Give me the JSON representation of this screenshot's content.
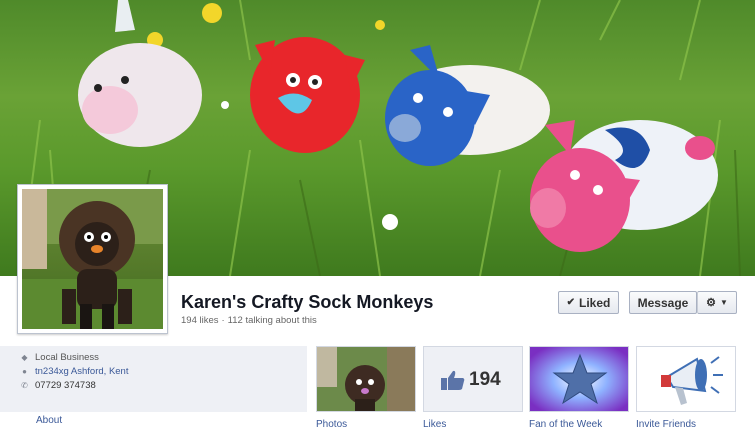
{
  "page": {
    "name": "Karen's Crafty Sock Monkeys",
    "likes_text": "194 likes",
    "talking_text": "112 talking about this",
    "separator": "·"
  },
  "actions": {
    "liked_label": "Liked",
    "message_label": "Message",
    "gear_icon": "gear-icon"
  },
  "info": {
    "category": "Local Business",
    "address": "tn234xg Ashford, Kent",
    "phone": "07729 374738",
    "about_label": "About"
  },
  "apps": [
    {
      "label": "Photos"
    },
    {
      "label": "Likes",
      "count": "194"
    },
    {
      "label": "Fan of the Week"
    },
    {
      "label": "Invite Friends"
    }
  ],
  "colors": {
    "link": "#3b5998",
    "panel_bg": "#eef0f5",
    "title": "#141823"
  }
}
